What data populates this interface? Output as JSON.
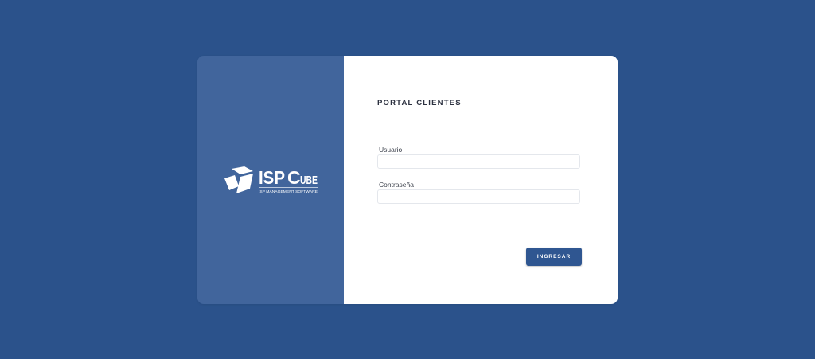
{
  "colors": {
    "page_background": "#2b528b",
    "brand_panel": "#41659c",
    "button": "#2f5691"
  },
  "brand": {
    "logo_name": "ISP",
    "logo_cube": "C",
    "logo_suffix": "UBE",
    "tagline": "ISP MANAGEMENT SOFTWARE",
    "icon": "cube-logo-icon"
  },
  "form": {
    "title": "PORTAL CLIENTES",
    "username_label": "Usuario",
    "username_value": "",
    "password_label": "Contraseña",
    "password_value": "",
    "submit_label": "INGRESAR"
  }
}
